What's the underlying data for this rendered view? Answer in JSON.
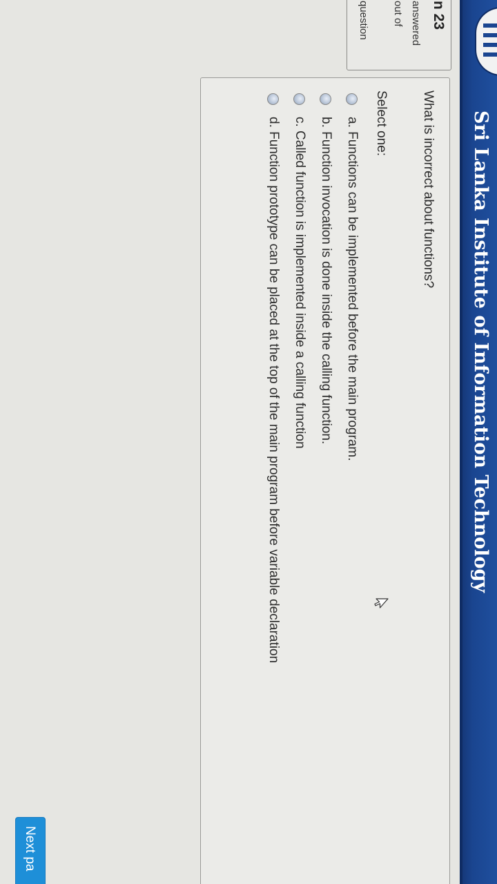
{
  "header": {
    "site_title": "Sri Lanka Institute of Information Technology",
    "bar_color": "#1a4590"
  },
  "question_info": {
    "number": "n 23",
    "status_line1": "answered",
    "status_line2": "out of",
    "status_line3": "question"
  },
  "question": {
    "text": "What is incorrect about functions?",
    "select_label": "Select one:",
    "options": [
      {
        "label": "a. Functions can be implemented before the main program."
      },
      {
        "label": "b. Function invocation is done inside the calling function."
      },
      {
        "label": "c. Called function is implemented inside a calling function"
      },
      {
        "label": "d. Function prototype can be placed at the top of the main program before variable declaration"
      }
    ]
  },
  "navigation": {
    "next_label": "Next pa",
    "button_color": "#1e8fd8"
  }
}
